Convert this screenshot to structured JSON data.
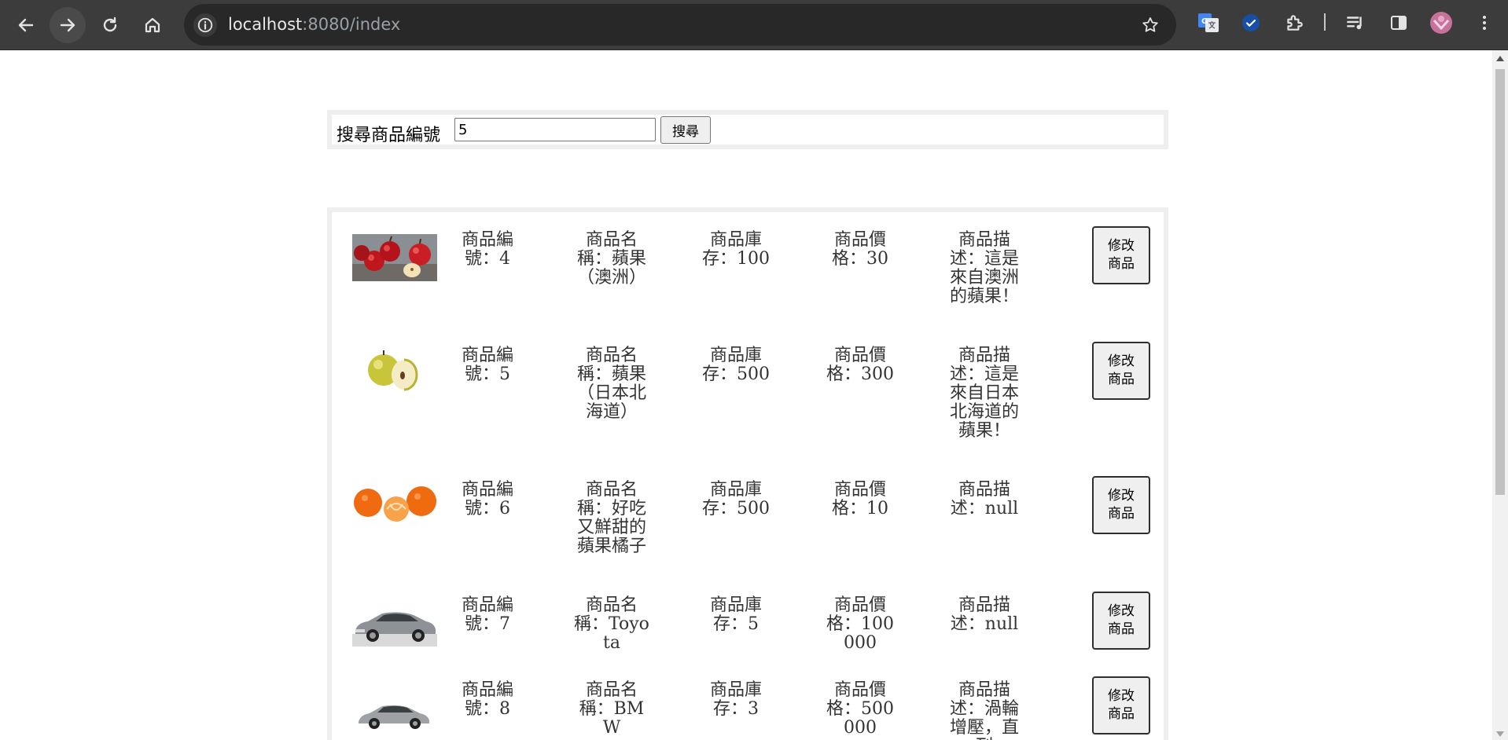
{
  "browser": {
    "url_host": "localhost",
    "url_rest": ":8080/index"
  },
  "search": {
    "label": "搜尋商品編號",
    "value": "5",
    "button_label": "搜尋"
  },
  "products": [
    {
      "id_text": "商品編號：4",
      "name_text": "商品名稱：蘋果（澳洲）",
      "stock_text": "商品庫存：100",
      "price_text": "商品價格：30",
      "desc_text": "商品描述：這是來自澳洲的蘋果！",
      "edit_label": "修改商品",
      "image": "red-apples"
    },
    {
      "id_text": "商品編號：5",
      "name_text": "商品名稱：蘋果（日本北海道）",
      "stock_text": "商品庫存：500",
      "price_text": "商品價格：300",
      "desc_text": "商品描述：這是來自日本北海道的蘋果！",
      "edit_label": "修改商品",
      "image": "yellow-apple"
    },
    {
      "id_text": "商品編號：6",
      "name_text": "商品名稱：好吃又鮮甜的蘋果橘子",
      "stock_text": "商品庫存：500",
      "price_text": "商品價格：10",
      "desc_text": "商品描述：null",
      "edit_label": "修改商品",
      "image": "tangerines"
    },
    {
      "id_text": "商品編號：7",
      "name_text": "商品名稱：Toyota",
      "stock_text": "商品庫存：5",
      "price_text": "商品價格：100000",
      "desc_text": "商品描述：null",
      "edit_label": "修改商品",
      "image": "toyota-car"
    },
    {
      "id_text": "商品編號：8",
      "name_text": "商品名稱：BMW",
      "stock_text": "商品庫存：3",
      "price_text": "商品價格：500000",
      "desc_text": "商品描述：渦輪增壓，直列",
      "edit_label": "修改商品",
      "image": "bmw-car"
    }
  ]
}
